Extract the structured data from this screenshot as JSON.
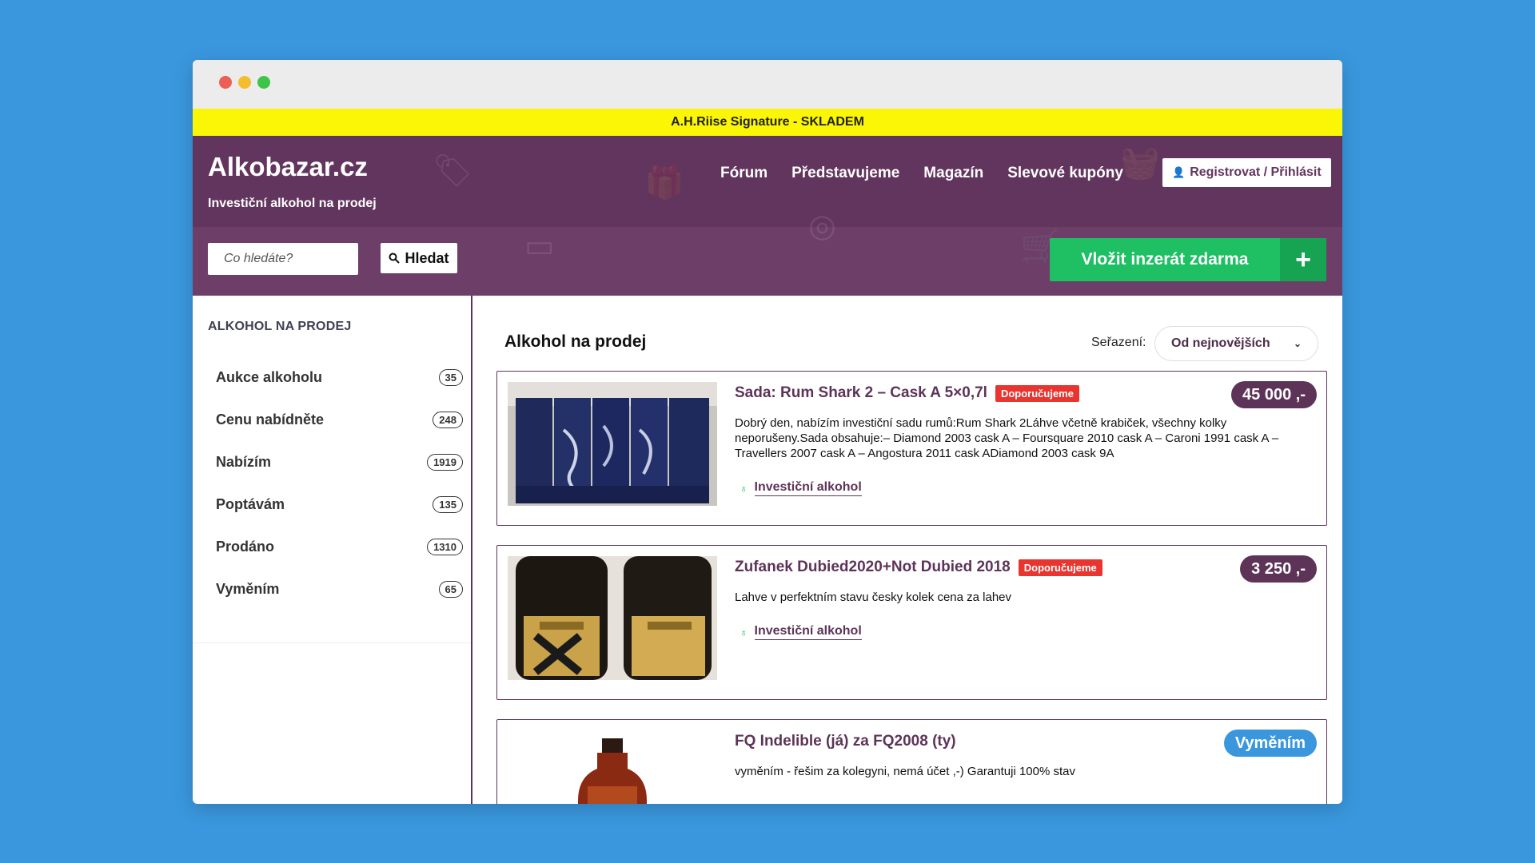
{
  "announcement": "A.H.Riise Signature - SKLADEM",
  "header": {
    "logo": "Alkobazar.cz",
    "tagline": "Investiční alkohol na prodej",
    "nav": [
      "Fórum",
      "Představujeme",
      "Magazín",
      "Slevové kupóny"
    ],
    "login_label": "Registrovat / Přihlásit",
    "search_placeholder": "Co hledáte?",
    "search_button": "Hledat",
    "cta_label": "Vložit inzerát zdarma",
    "cta_plus": "+"
  },
  "sidebar": {
    "title": "ALKOHOL NA PRODEJ",
    "categories": [
      {
        "name": "Aukce alkoholu",
        "count": "35"
      },
      {
        "name": "Cenu nabídněte",
        "count": "248"
      },
      {
        "name": "Nabízím",
        "count": "1919"
      },
      {
        "name": "Poptávám",
        "count": "135"
      },
      {
        "name": "Prodáno",
        "count": "1310"
      },
      {
        "name": "Vyměním",
        "count": "65"
      }
    ]
  },
  "main": {
    "title": "Alkohol na prodej",
    "sort_label": "Seřazení:",
    "sort_value": "Od nejnovějších",
    "listings": [
      {
        "title": "Sada: Rum Shark 2 – Cask A 5×0,7l",
        "badge": "Doporučujeme",
        "price": "45 000 ,-",
        "description": "Dobrý den, nabízím investiční sadu rumů:Rum Shark 2Láhve včetně krabiček, všechny kolky neporušeny.Sada obsahuje:– Diamond 2003 cask A – Foursquare 2010 cask A – Caroni 1991 cask A – Travellers 2007 cask A – Angostura 2011 cask ADiamond 2003 cask 9A",
        "tag": "Investiční alkohol"
      },
      {
        "title": "Zufanek Dubied2020+Not Dubied 2018",
        "badge": "Doporučujeme",
        "price": "3 250 ,-",
        "description": "Lahve v perfektním stavu česky kolek cena za lahev",
        "tag": "Investiční alkohol"
      },
      {
        "title": "FQ Indelible (já) za FQ2008 (ty)",
        "price": "Vyměním",
        "description": "vyměním - řešim za kolegyni, nemá účet ,-) Garantuji 100% stav"
      }
    ]
  },
  "colors": {
    "brand": "#62355e",
    "announce": "#fbf605",
    "cta": "#1fbf64",
    "badge": "#e8352f",
    "swap": "#3a97dd"
  }
}
